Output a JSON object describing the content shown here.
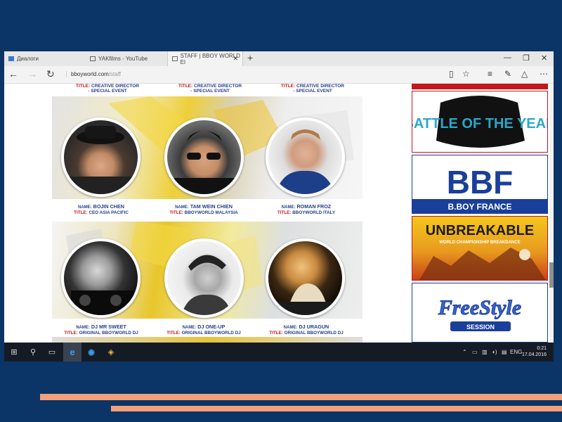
{
  "browser": {
    "tabs": [
      {
        "label": "Диалоги",
        "active": false
      },
      {
        "label": "YAKfilms - YouTube",
        "active": false
      },
      {
        "label": "STAFF | BBOY WORLD EI",
        "active": true
      }
    ],
    "new_tab": "+",
    "window_controls": {
      "minimize": "—",
      "restore": "❐",
      "close": "✕"
    },
    "url_domain": "bboyworld.com",
    "url_path": "/staff"
  },
  "page": {
    "top_titles": [
      {
        "key": "TITLE:",
        "line1": "CREATIVE DIRECTOR",
        "line2": "- SPECIAL EVENT"
      },
      {
        "key": "TITLE:",
        "line1": "CREATIVE DIRECTOR",
        "line2": "- SPECIAL EVENT"
      },
      {
        "key": "TITLE:",
        "line1": "CREATIVE DIRECTOR",
        "line2": "- SPECIAL EVENT"
      }
    ],
    "staff": [
      {
        "name_key": "NAME:",
        "name": "BOJIN CHEN",
        "title_key": "TITLE:",
        "title": "CEO ASIA PACIFIC"
      },
      {
        "name_key": "NAME:",
        "name": "TAM WEIN CHIEN",
        "title_key": "TITLE:",
        "title": "BBOYWORLD MALAYSIA"
      },
      {
        "name_key": "NAME:",
        "name": "ROMAN FROZ",
        "title_key": "TITLE:",
        "title": "BBOYWORLD ITALY"
      },
      {
        "name_key": "NAME:",
        "name": "DJ MR SWEET",
        "title_key": "TITLE:",
        "title": "ORIGINAL BBOYWORLD DJ"
      },
      {
        "name_key": "NAME:",
        "name": "DJ ONE-UP",
        "title_key": "TITLE:",
        "title": "ORIGINAL BBOYWORLD DJ"
      },
      {
        "name_key": "NAME:",
        "name": "DJ URAGUN",
        "title_key": "TITLE:",
        "title": "ORIGINAL BBOYWORLD DJ"
      }
    ]
  },
  "sidebar": {
    "ads": [
      {
        "text": "BATTLE OF THE YEAR"
      },
      {
        "text": "BBF",
        "sub": "B.BOY FRANCE"
      },
      {
        "text": "UNBREAKABLE",
        "sub": "WORLD CHAMPIONSHIP BREAKDANCE"
      },
      {
        "text": "FreeStyle",
        "sub": "SESSION"
      }
    ]
  },
  "taskbar": {
    "language": "ENG",
    "time": "0:21",
    "date": "17.04.2016"
  }
}
